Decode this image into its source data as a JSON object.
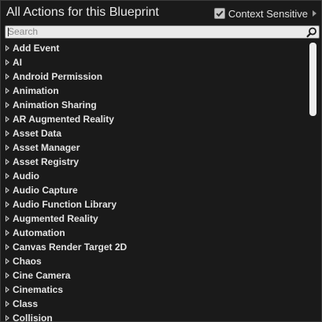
{
  "header": {
    "title": "All Actions for this Blueprint",
    "context_sensitive_label": "Context Sensitive",
    "context_sensitive_checked": true
  },
  "search": {
    "placeholder": "Search",
    "value": ""
  },
  "categories": [
    "Add Event",
    "AI",
    "Android Permission",
    "Animation",
    "Animation Sharing",
    "AR Augmented Reality",
    "Asset Data",
    "Asset Manager",
    "Asset Registry",
    "Audio",
    "Audio Capture",
    "Audio Function Library",
    "Augmented Reality",
    "Automation",
    "Canvas Render Target 2D",
    "Chaos",
    "Cine Camera",
    "Cinematics",
    "Class",
    "Collision"
  ],
  "colors": {
    "background": "#1a1a1a",
    "text": "#e4e4e4",
    "search_bg": "#e9e9e9",
    "scroll_thumb": "#ececec"
  },
  "icons": {
    "search": "magnifier-icon",
    "expand": "expand-arrow-icon",
    "checkbox": "checkmark-icon",
    "context_arrow": "triangle-right-icon"
  }
}
